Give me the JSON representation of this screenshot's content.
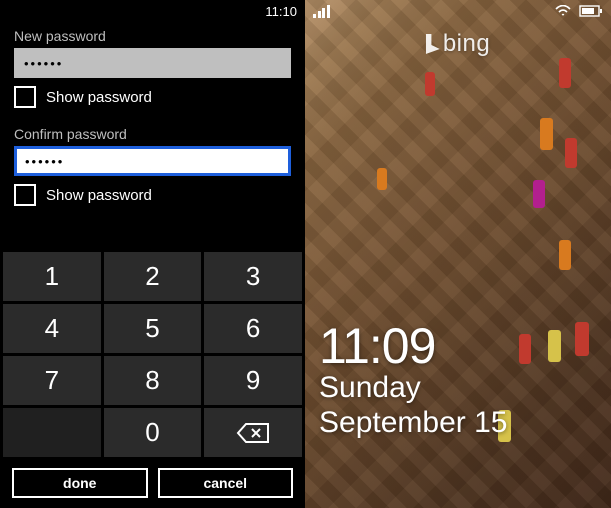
{
  "left": {
    "status_time": "11:10",
    "new_password_label": "New password",
    "new_password_value": "••••••",
    "show_password_1": "Show password",
    "confirm_password_label": "Confirm password",
    "confirm_password_value": "••••••",
    "show_password_2": "Show password",
    "keys": {
      "k1": "1",
      "k2": "2",
      "k3": "3",
      "k4": "4",
      "k5": "5",
      "k6": "6",
      "k7": "7",
      "k8": "8",
      "k9": "9",
      "k0": "0"
    },
    "done": "done",
    "cancel": "cancel"
  },
  "right": {
    "brand": "bing",
    "time": "11:09",
    "day": "Sunday",
    "date": "September 15"
  }
}
